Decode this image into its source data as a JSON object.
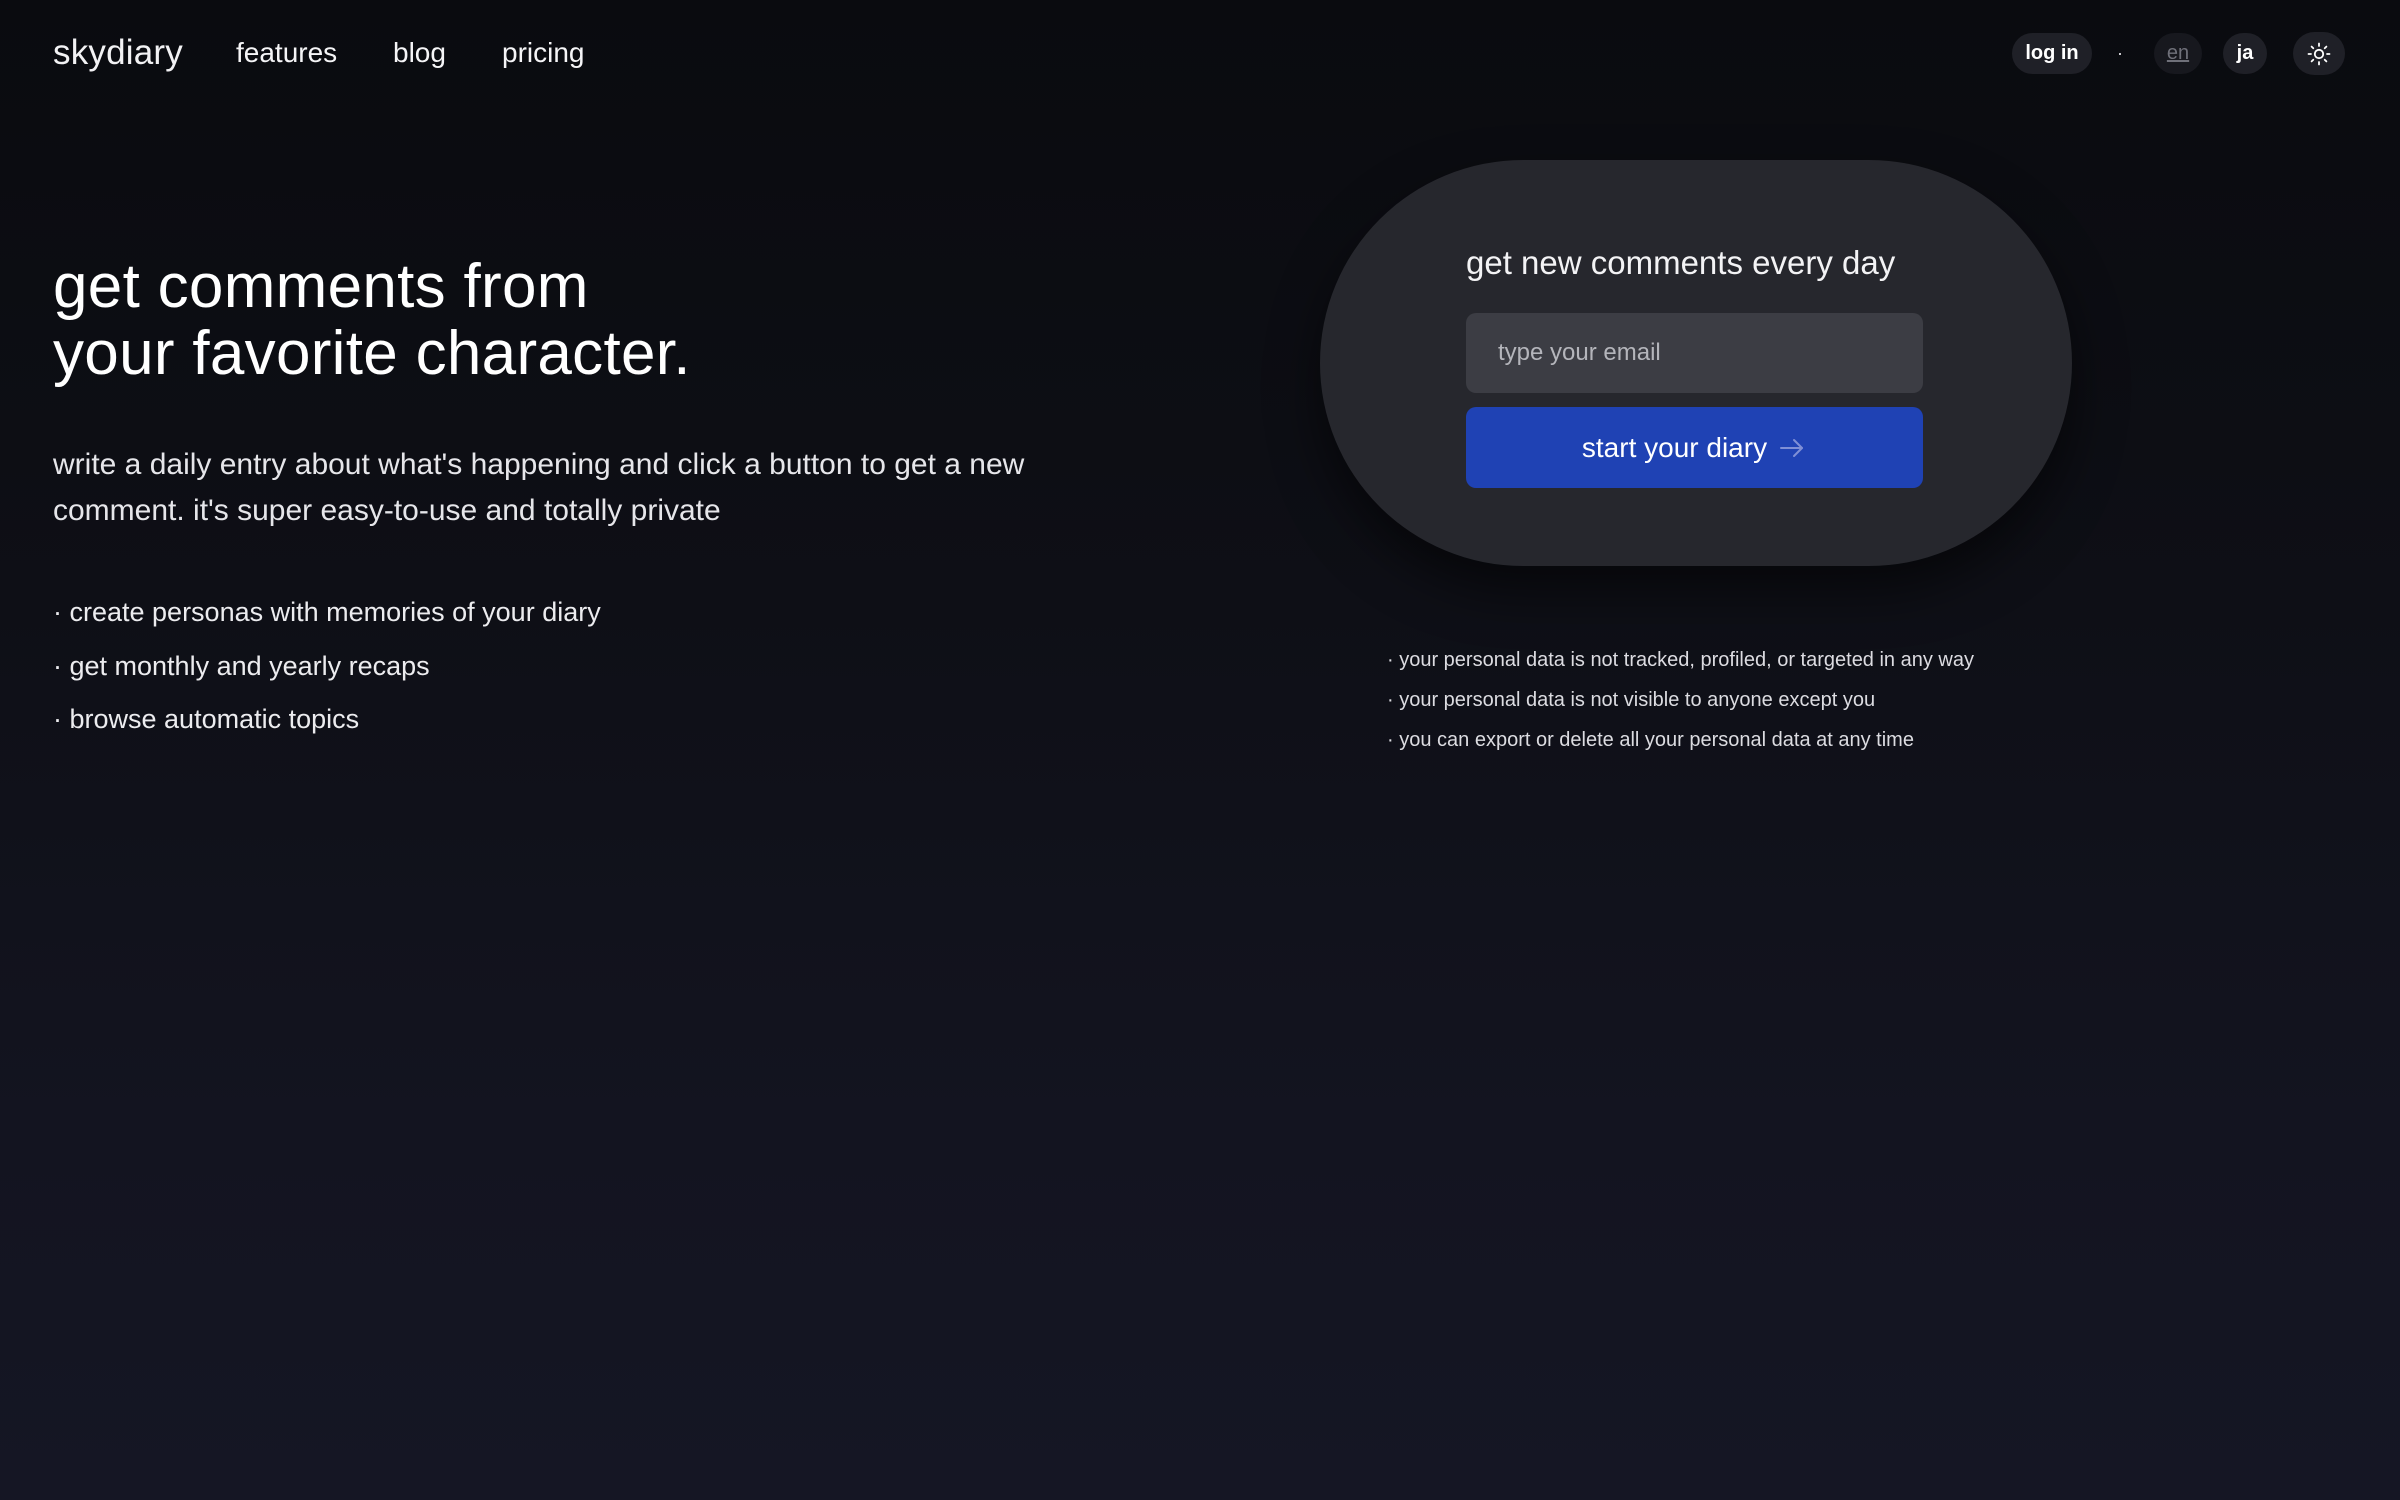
{
  "header": {
    "brand": "skydiary",
    "nav": {
      "features": "features",
      "blog": "blog",
      "pricing": "pricing"
    },
    "login_label": "log in",
    "separator": "·",
    "languages": {
      "en": "en",
      "ja": "ja",
      "selected": "en"
    },
    "theme_icon": "sun-icon"
  },
  "hero": {
    "title_line1": "get comments from",
    "title_line2": "your favorite character.",
    "description": "write a daily entry about what's happening and click a button to get a new comment. it's super easy-to-use and totally private",
    "features": [
      "· create personas with memories of your diary",
      "· get monthly and yearly recaps",
      "· browse automatic topics"
    ]
  },
  "signup": {
    "title": "get new comments every day",
    "email_placeholder": "type your email",
    "email_value": "",
    "button_label": "start your diary",
    "button_icon": "arrow-right-icon"
  },
  "privacy": [
    "· your personal data is not tracked, profiled, or targeted in any way",
    "· your personal data is not visible to anyone except you",
    "· you can export or delete all your personal data at any time"
  ],
  "colors": {
    "background_top": "#0a0b0f",
    "background_bottom": "#151624",
    "card": "#26272d",
    "input": "#3c3d44",
    "accent_button": "#1f42b4",
    "pill": "#1f2027"
  }
}
